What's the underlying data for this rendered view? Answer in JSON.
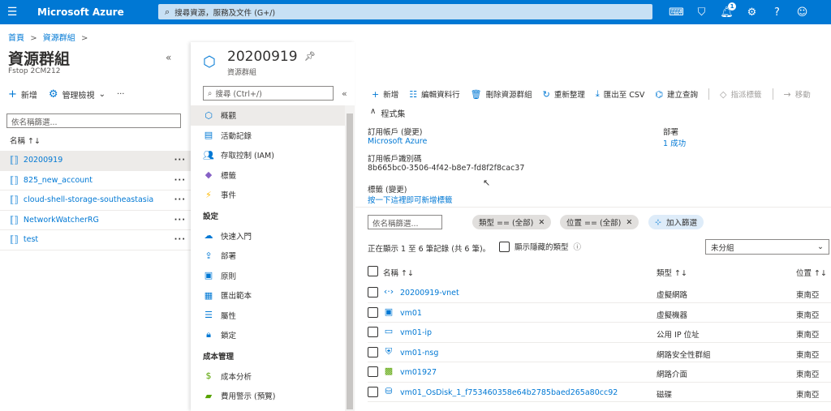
{
  "header": {
    "brand": "Microsoft Azure",
    "search_placeholder": "搜尋資源，服務及文件 (G+/)",
    "notif_count": "1",
    "icons": [
      "cloud-shell-icon",
      "directory-filter-icon",
      "bell-icon",
      "gear-icon",
      "help-icon",
      "feedback-icon"
    ]
  },
  "breadcrumb": {
    "home": "首頁",
    "rg": "資源群組",
    "sep": ">"
  },
  "left": {
    "title": "資源群組",
    "subtitle": "Fstop 2CM212",
    "new": "新增",
    "manage_view": "管理檢視",
    "more": "···",
    "filter_placeholder": "依名稱篩選...",
    "col_name": "名稱 ↑↓",
    "items": [
      {
        "name": "20200919"
      },
      {
        "name": "825_new_account"
      },
      {
        "name": "cloud-shell-storage-southeastasia"
      },
      {
        "name": "NetworkWatcherRG"
      },
      {
        "name": "test"
      }
    ]
  },
  "resource": {
    "title": "20200919",
    "subtitle": "資源群組"
  },
  "menu": {
    "search_placeholder": "搜尋 (Ctrl+/)",
    "items": [
      {
        "label": "概觀",
        "icon": "overview-icon"
      },
      {
        "label": "活動記錄",
        "icon": "activity-log-icon"
      },
      {
        "label": "存取控制 (IAM)",
        "icon": "iam-icon"
      },
      {
        "label": "標籤",
        "icon": "tag-icon"
      },
      {
        "label": "事件",
        "icon": "events-icon"
      }
    ],
    "section_settings": "設定",
    "settings": [
      {
        "label": "快速入門",
        "icon": "quickstart-icon"
      },
      {
        "label": "部署",
        "icon": "deployments-icon"
      },
      {
        "label": "原則",
        "icon": "policies-icon"
      },
      {
        "label": "匯出範本",
        "icon": "export-template-icon"
      },
      {
        "label": "屬性",
        "icon": "properties-icon"
      },
      {
        "label": "鎖定",
        "icon": "lock-icon"
      }
    ],
    "section_cost": "成本管理",
    "cost": [
      {
        "label": "成本分析",
        "icon": "cost-analysis-icon"
      },
      {
        "label": "費用警示 (預覽)",
        "icon": "cost-alerts-icon"
      }
    ]
  },
  "commands": {
    "add": "新增",
    "edit_columns": "編輯資料行",
    "delete": "刪除資源群組",
    "refresh": "重新整理",
    "export_csv": "匯出至 CSV",
    "open_query": "建立查詢",
    "assign_tags": "指派標籤",
    "move": "移動"
  },
  "essentials": {
    "label": "程式集",
    "subscription_label": "訂用帳戶 (變更)",
    "subscription": "Microsoft Azure",
    "subscription_id_label": "訂用帳戶識別碼",
    "subscription_id": "8b665bc0-3506-4f42-b8e7-fd8f2f8cac37",
    "deployments_label": "部署",
    "deployments": "1 成功",
    "tags_label": "標籤 (變更)",
    "tags_link": "按一下這裡即可新增標籤"
  },
  "filters": {
    "name_placeholder": "依名稱篩選...",
    "type_pill": "類型 == (全部)",
    "location_pill": "位置 == (全部)",
    "add_filter": "加入篩選"
  },
  "records": {
    "showing": "正在顯示 1 至 6 筆記錄 (共 6 筆)。",
    "show_hidden": "顯示隱藏的類型",
    "grouping": "未分組"
  },
  "table": {
    "col_name": "名稱 ↑↓",
    "col_type": "類型 ↑↓",
    "col_location": "位置 ↑↓",
    "rows": [
      {
        "name": "20200919-vnet",
        "type": "虛擬網路",
        "location": "東南亞",
        "icon": "vnet-icon"
      },
      {
        "name": "vm01",
        "type": "虛擬機器",
        "location": "東南亞",
        "icon": "vm-icon"
      },
      {
        "name": "vm01-ip",
        "type": "公用 IP 位址",
        "location": "東南亞",
        "icon": "public-ip-icon"
      },
      {
        "name": "vm01-nsg",
        "type": "網路安全性群組",
        "location": "東南亞",
        "icon": "nsg-icon"
      },
      {
        "name": "vm01927",
        "type": "網路介面",
        "location": "東南亞",
        "icon": "nic-icon"
      },
      {
        "name": "vm01_OsDisk_1_f753460358e64b2785baed265a80cc92",
        "type": "磁碟",
        "location": "東南亞",
        "icon": "disk-icon"
      }
    ]
  }
}
